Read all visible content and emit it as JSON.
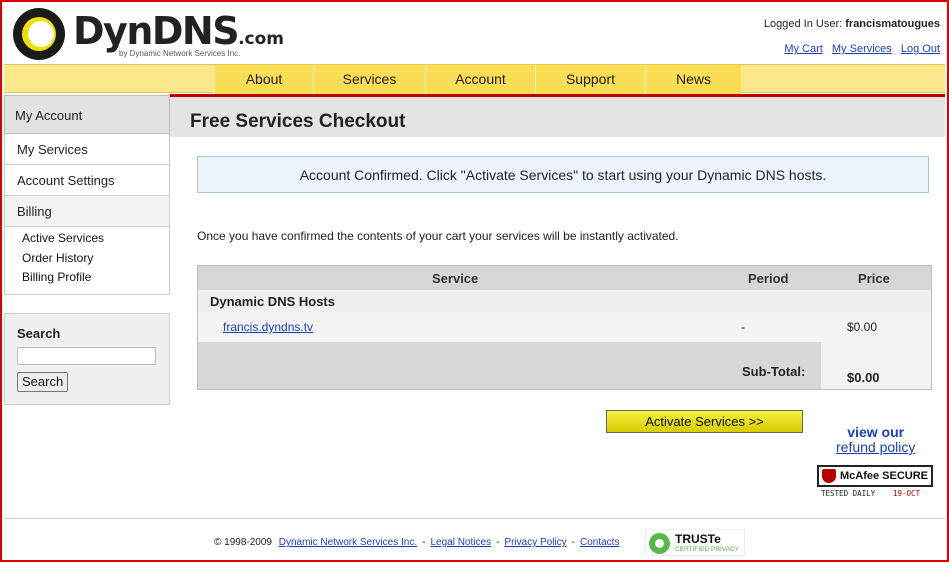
{
  "brand": {
    "name": "DynDNS",
    "suffix": ".com",
    "tagline": "by Dynamic Network Services Inc."
  },
  "user": {
    "label": "Logged In User:",
    "name": "francismatougues",
    "links": [
      "My Cart",
      "My Services",
      "Log Out"
    ]
  },
  "nav": [
    "About",
    "Services",
    "Account",
    "Support",
    "News"
  ],
  "sidebar": {
    "heading": "My Account",
    "items": [
      "My Services",
      "Account Settings",
      "Billing"
    ],
    "billing_sub": [
      "Active Services",
      "Order History",
      "Billing Profile"
    ]
  },
  "search": {
    "title": "Search",
    "button": "Search",
    "value": ""
  },
  "page": {
    "title": "Free Services Checkout",
    "notice": "Account Confirmed. Click \"Activate Services\" to start using your Dynamic DNS hosts.",
    "intro": "Once you have confirmed the contents of your cart your services will be instantly activated."
  },
  "cart": {
    "headers": [
      "Service",
      "Period",
      "Price"
    ],
    "group": "Dynamic DNS Hosts",
    "rows": [
      {
        "service": "francis.dyndns.tv",
        "period": "-",
        "price": "$0.00"
      }
    ],
    "subtotal_label": "Sub-Total:",
    "subtotal_value": "$0.00"
  },
  "actions": {
    "activate": "Activate Services >>",
    "refund_a": "view our",
    "refund_b": "refund policy"
  },
  "badges": {
    "mcafee": "McAfee SECURE",
    "mcafee_tested": "TESTED DAILY",
    "mcafee_date": "19-OCT",
    "truste": "TRUSTe",
    "truste_sub": "CERTIFIED PRIVACY"
  },
  "footer": {
    "copyright": "© 1998-2009",
    "links": [
      "Dynamic Network Services Inc.",
      "Legal Notices",
      "Privacy Policy",
      "Contacts"
    ]
  },
  "colors": {
    "accent_red": "#c00000",
    "nav_yellow": "#f9de55",
    "link_blue": "#1a3fb8"
  }
}
